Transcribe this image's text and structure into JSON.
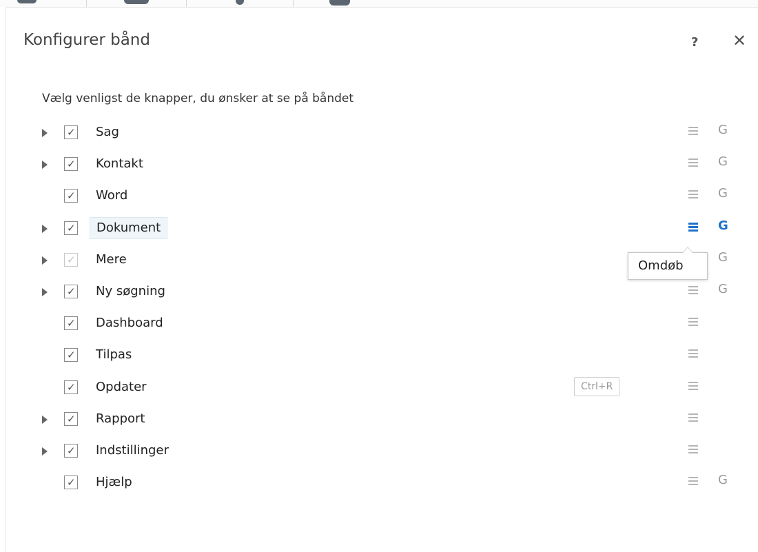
{
  "dialog": {
    "title": "Konfigurer bånd",
    "help_label": "?",
    "close_label": "✕",
    "instruction": "Vælg venligst de knapper, du ønsker at se på båndet"
  },
  "tooltip": {
    "text": "Omdøb"
  },
  "colors": {
    "accent": "#1f72c8",
    "selected_bg": "#eef6fa"
  },
  "items": [
    {
      "label": "Sag",
      "expandable": true,
      "checked": true,
      "group": "G",
      "shortcut": ""
    },
    {
      "label": "Kontakt",
      "expandable": true,
      "checked": true,
      "group": "G",
      "shortcut": ""
    },
    {
      "label": "Word",
      "expandable": false,
      "checked": true,
      "group": "G",
      "shortcut": ""
    },
    {
      "label": "Dokument",
      "expandable": true,
      "checked": true,
      "group": "G",
      "shortcut": "",
      "selected": true
    },
    {
      "label": "Mere",
      "expandable": true,
      "checked": true,
      "dimmed": true,
      "group": "G",
      "shortcut": ""
    },
    {
      "label": "Ny søgning",
      "expandable": true,
      "checked": true,
      "group": "G",
      "shortcut": ""
    },
    {
      "label": "Dashboard",
      "expandable": false,
      "checked": true,
      "group": "",
      "shortcut": ""
    },
    {
      "label": "Tilpas",
      "expandable": false,
      "checked": true,
      "group": "",
      "shortcut": ""
    },
    {
      "label": "Opdater",
      "expandable": false,
      "checked": true,
      "group": "",
      "shortcut": "Ctrl+R"
    },
    {
      "label": "Rapport",
      "expandable": true,
      "checked": true,
      "group": "",
      "shortcut": ""
    },
    {
      "label": "Indstillinger",
      "expandable": true,
      "checked": true,
      "group": "",
      "shortcut": ""
    },
    {
      "label": "Hjælp",
      "expandable": false,
      "checked": true,
      "group": "G",
      "shortcut": ""
    }
  ]
}
